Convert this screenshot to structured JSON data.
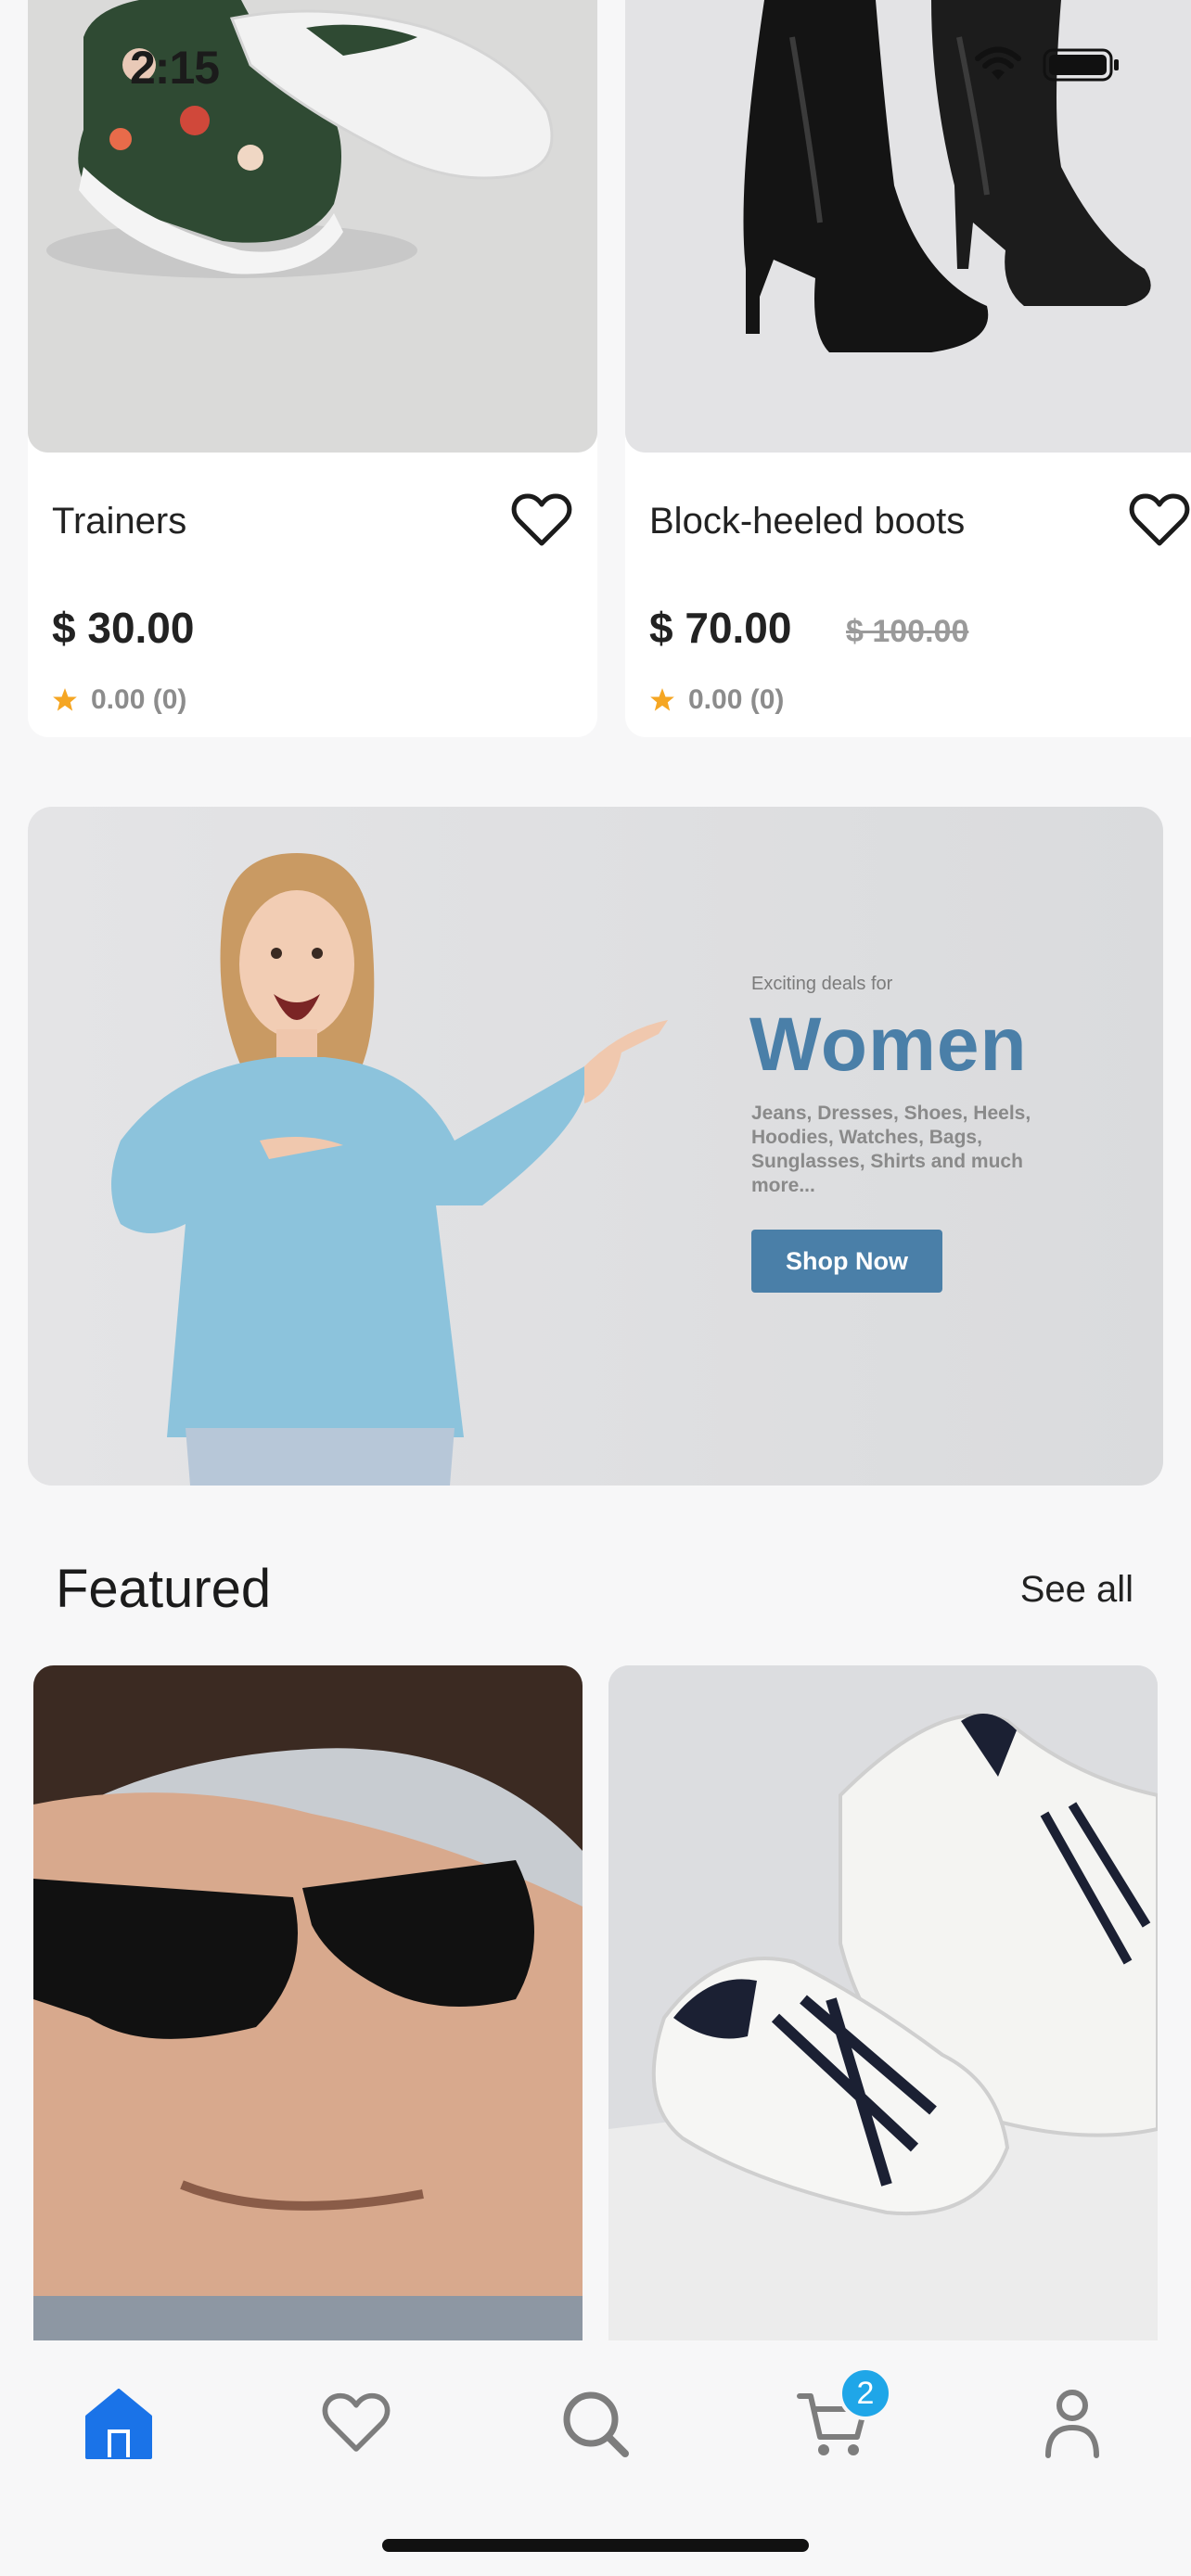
{
  "status": {
    "time": "2:15"
  },
  "products": [
    {
      "name": "Trainers",
      "price": "$ 30.00",
      "old_price": "",
      "rating": "0.00 (0)"
    },
    {
      "name": "Block-heeled boots",
      "price": "$ 70.00",
      "old_price": "$ 100.00",
      "rating": "0.00 (0)"
    }
  ],
  "banner": {
    "kicker": "Exciting deals for",
    "title": "Women",
    "description": "Jeans, Dresses, Shoes, Heels, Hoodies, Watches, Bags, Sunglasses, Shirts and much more...",
    "cta": "Shop Now"
  },
  "featured": {
    "title": "Featured",
    "see_all": "See all"
  },
  "tabbar": {
    "cart_count": "2"
  },
  "colors": {
    "accent": "#1a73e8",
    "brand_blue": "#4a7fa8",
    "badge": "#1fa6e8",
    "star": "#f5a623"
  }
}
